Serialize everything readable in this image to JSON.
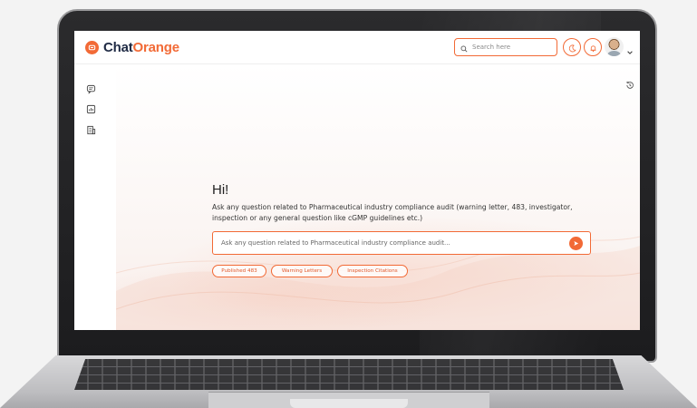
{
  "app": {
    "brand_part1": "Chat",
    "brand_part2": "Orange"
  },
  "header": {
    "search_placeholder": "Search here",
    "icons": [
      "search-icon",
      "moon-icon",
      "bell-icon",
      "avatar",
      "chevron-down-icon"
    ]
  },
  "sidebar": {
    "items": [
      {
        "icon": "chat-icon"
      },
      {
        "icon": "report-icon"
      },
      {
        "icon": "building-icon"
      }
    ]
  },
  "main": {
    "greeting": "Hi!",
    "subtext": "Ask any question related to Pharmaceutical industry compliance audit (warning letter, 483, investigator, inspection or any general question like cGMP guidelines etc.)",
    "input_placeholder": "Ask any question related to Pharmaceutical industry compliance audit...",
    "chips": [
      {
        "label": "Published 483"
      },
      {
        "label": "Warning Letters"
      },
      {
        "label": "Inspection Citations"
      }
    ]
  },
  "colors": {
    "accent": "#f26a36",
    "brand_dark": "#1f2a44"
  }
}
